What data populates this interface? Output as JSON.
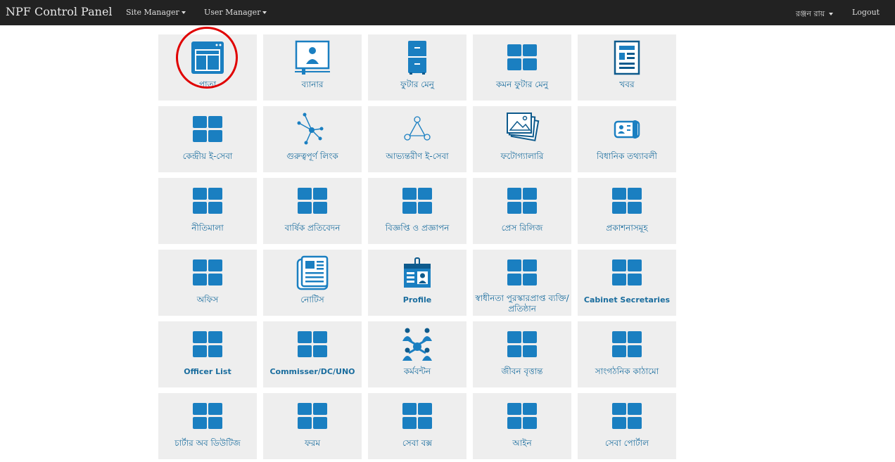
{
  "navbar": {
    "brand": "NPF Control Panel",
    "site_manager": "Site Manager",
    "user_manager": "User Manager",
    "user_name": "রঞ্জন রায়",
    "logout": "Logout"
  },
  "colors": {
    "accent": "#1a7fc1",
    "tile_bg": "#eeeeee",
    "navbar_bg": "#222222",
    "highlight": "#e00000"
  },
  "tiles": [
    {
      "label": "পাতা",
      "icon": "page-layout-icon"
    },
    {
      "label": "ব্যানার",
      "icon": "banner-icon"
    },
    {
      "label": "ফুটার মেনু",
      "icon": "footer-menu-icon"
    },
    {
      "label": "কমন ফুটার মেনু",
      "icon": "grid-icon"
    },
    {
      "label": "খবর",
      "icon": "news-icon"
    },
    {
      "label": "কেন্দ্রীয় ই-সেবা",
      "icon": "grid-icon"
    },
    {
      "label": "গুরুত্বপূর্ণ লিংক",
      "icon": "network-icon"
    },
    {
      "label": "আভ্যন্তরীণ ই-সেবা",
      "icon": "triangle-nodes-icon"
    },
    {
      "label": "ফটোগ্যালারি",
      "icon": "photo-gallery-icon"
    },
    {
      "label": "বিধানিক তথ্যাবলী",
      "icon": "id-card-icon"
    },
    {
      "label": "নীতিমালা",
      "icon": "grid-icon"
    },
    {
      "label": "বার্ষিক প্রতিবেদন",
      "icon": "grid-icon"
    },
    {
      "label": "বিজ্ঞপ্তি ও প্রজ্ঞাপন",
      "icon": "grid-icon"
    },
    {
      "label": "প্রেস রিলিজ",
      "icon": "grid-icon"
    },
    {
      "label": "প্রকাশনাসমূহ",
      "icon": "grid-icon"
    },
    {
      "label": "অফিস",
      "icon": "grid-icon"
    },
    {
      "label": "নোটিস",
      "icon": "notice-icon"
    },
    {
      "label": "Profile",
      "icon": "profile-badge-icon"
    },
    {
      "label": "স্বাধীনতা পুরস্কারপ্রাপ্ত ব্যক্তি/প্রতিষ্ঠান",
      "icon": "grid-icon"
    },
    {
      "label": "Cabinet Secretaries",
      "icon": "grid-icon"
    },
    {
      "label": "Officer List",
      "icon": "grid-icon"
    },
    {
      "label": "Commisser/DC/UNO",
      "icon": "grid-icon"
    },
    {
      "label": "কর্মবন্টন",
      "icon": "people-network-icon"
    },
    {
      "label": "জীবন বৃত্তান্ত",
      "icon": "grid-icon"
    },
    {
      "label": "সাংগঠনিক কাঠামো",
      "icon": "grid-icon"
    },
    {
      "label": "চার্টার অব ডিউটিজ",
      "icon": "grid-icon"
    },
    {
      "label": "ফরম",
      "icon": "grid-icon"
    },
    {
      "label": "সেবা বক্স",
      "icon": "grid-icon"
    },
    {
      "label": "আইন",
      "icon": "grid-icon"
    },
    {
      "label": "সেবা পোর্টাল",
      "icon": "grid-icon"
    }
  ]
}
